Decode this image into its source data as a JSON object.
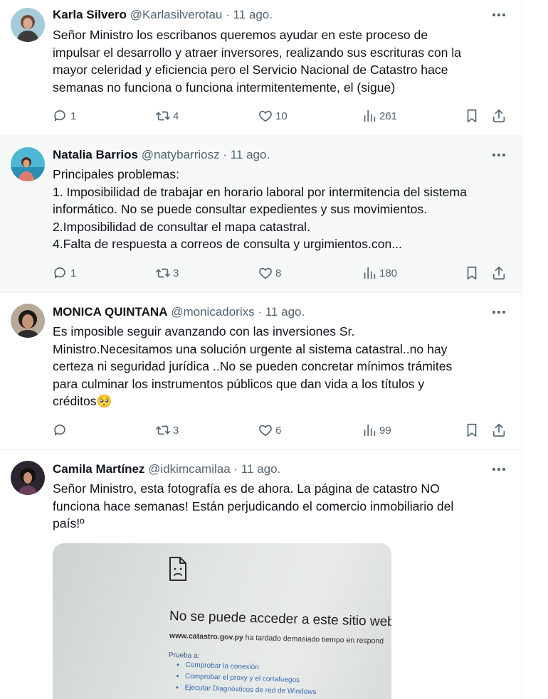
{
  "tweets": [
    {
      "name": "Karla Silvero",
      "handle": "@Karlasilverotau",
      "date": "· 11 ago.",
      "text": "Señor Ministro los escribanos queremos ayudar en este proceso de\nimpulsar el desarrollo y atraer inversores, realizando sus escrituras con la\nmayor celeridad y eficiencia pero el Servicio Nacional de Catastro hace\nsemanas no funciona o funciona intermitentemente, el (sigue)",
      "replies": "1",
      "reposts": "4",
      "likes": "10",
      "views": "261"
    },
    {
      "name": "Natalia Barrios",
      "handle": "@natybarriosz",
      "date": "· 11 ago.",
      "text": "Principales problemas:\n1. Imposibilidad de trabajar en horario laboral por  intermitencia del sistema\ninformático. No se puede consultar expedientes y sus movimientos.\n2.Imposibilidad de consultar el mapa catastral.\n4.Falta de respuesta a correos de consulta y urgimientos.con...",
      "replies": "1",
      "reposts": "3",
      "likes": "8",
      "views": "180"
    },
    {
      "name": "MONICA QUINTANA",
      "handle": "@monicadorixs",
      "date": "· 11 ago.",
      "text": "Es imposible seguir avanzando con las inversiones Sr.\nMinistro.Necesitamos una solución  urgente al sistema catastral..no hay\ncerteza ni seguridad jurídica ..No se pueden concretar mínimos trámites\npara culminar los instrumentos públicos que dan vida a los títulos y\ncréditos🥺",
      "replies": "",
      "reposts": "3",
      "likes": "6",
      "views": "99"
    },
    {
      "name": "Camila Martínez",
      "handle": "@idkimcamilaa",
      "date": "· 11 ago.",
      "text": "Señor Ministro, esta fotografía es de ahora. La página de catastro NO\nfunciona hace semanas! Están perjudicando el comercio inmobiliario del\npaís!º"
    }
  ],
  "photo": {
    "title": "No se puede acceder a este sitio web",
    "url_bold": "www.catastro.gov.py",
    "url_rest": " ha tardado demasiado tiempo en respond",
    "try_label": "Prueba a:",
    "suggestions": [
      "Comprobar la conexión",
      "Comprobar el proxy y el cortafuegos",
      "Ejecutar Diagnósticos de red de Windows"
    ]
  },
  "icons": {
    "reply": "reply-icon",
    "repost": "repost-icon",
    "like": "heart-icon",
    "views": "analytics-icon",
    "bookmark": "bookmark-icon",
    "share": "share-icon",
    "more": "more-icon"
  },
  "colors": {
    "muted": "#536471",
    "text": "#0f1419",
    "divider": "#eff3f4",
    "hover_bg": "#f7f9f9"
  }
}
